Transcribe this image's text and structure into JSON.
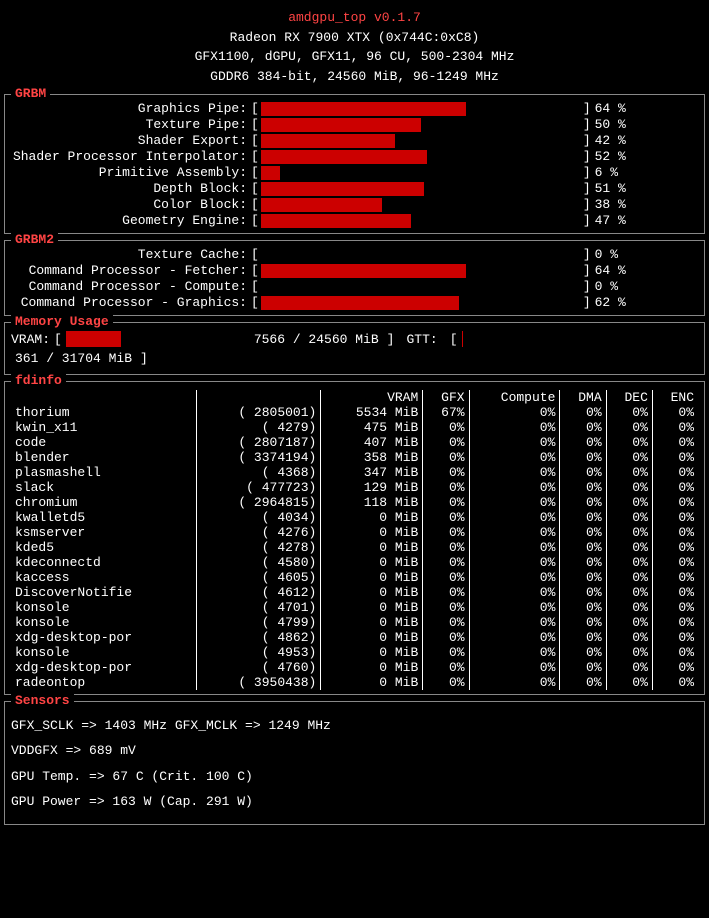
{
  "app": {
    "title": "amdgpu_top v0.1.7",
    "gpu_line1": "Radeon RX 7900 XTX (0x744C:0xC8)",
    "gpu_line2": "GFX1100, dGPU, GFX11, 96 CU, 500-2304 MHz",
    "gpu_line3": "GDDR6 384-bit, 24560 MiB, 96-1249 MHz"
  },
  "grbm": {
    "label": "GRBM",
    "rows": [
      {
        "label": "Graphics Pipe:",
        "pct": 64
      },
      {
        "label": "Texture Pipe:",
        "pct": 50
      },
      {
        "label": "Shader Export:",
        "pct": 42
      },
      {
        "label": "Shader Processor Interpolator:",
        "pct": 52
      },
      {
        "label": "Primitive Assembly:",
        "pct": 6
      },
      {
        "label": "Depth Block:",
        "pct": 51
      },
      {
        "label": "Color Block:",
        "pct": 38
      },
      {
        "label": "Geometry Engine:",
        "pct": 47
      }
    ]
  },
  "grbm2": {
    "label": "GRBM2",
    "rows": [
      {
        "label": "Texture Cache:",
        "pct": 0
      },
      {
        "label": "Command Processor -  Fetcher:",
        "pct": 64
      },
      {
        "label": "Command Processor -  Compute:",
        "pct": 0
      },
      {
        "label": "Command Processor - Graphics:",
        "pct": 62
      }
    ]
  },
  "memory": {
    "label": "Memory Usage",
    "vram_label": "VRAM:",
    "vram_used": 7566,
    "vram_total": 24560,
    "vram_unit": "MiB",
    "vram_pct": 30.8,
    "gtt_label": "GTT:",
    "gtt_used": 361,
    "gtt_total": 31704,
    "gtt_unit": "MiB",
    "gtt_pct": 1.1
  },
  "fdinfo": {
    "label": "fdinfo",
    "headers": [
      "",
      "",
      "VRAM",
      "GFX",
      "Compute",
      "DMA",
      "DEC",
      "ENC"
    ],
    "rows": [
      {
        "name": "thorium",
        "pid": "2805001",
        "vram": "5534 MiB",
        "gfx": "67%",
        "compute": "0%",
        "dma": "0%",
        "dec": "0%",
        "enc": "0%"
      },
      {
        "name": "kwin_x11",
        "pid": "4279",
        "vram": "475 MiB",
        "gfx": "0%",
        "compute": "0%",
        "dma": "0%",
        "dec": "0%",
        "enc": "0%"
      },
      {
        "name": "code",
        "pid": "2807187",
        "vram": "407 MiB",
        "gfx": "0%",
        "compute": "0%",
        "dma": "0%",
        "dec": "0%",
        "enc": "0%"
      },
      {
        "name": "blender",
        "pid": "3374194",
        "vram": "358 MiB",
        "gfx": "0%",
        "compute": "0%",
        "dma": "0%",
        "dec": "0%",
        "enc": "0%"
      },
      {
        "name": "plasmashell",
        "pid": "4368",
        "vram": "347 MiB",
        "gfx": "0%",
        "compute": "0%",
        "dma": "0%",
        "dec": "0%",
        "enc": "0%"
      },
      {
        "name": "slack",
        "pid": "477723",
        "vram": "129 MiB",
        "gfx": "0%",
        "compute": "0%",
        "dma": "0%",
        "dec": "0%",
        "enc": "0%"
      },
      {
        "name": "chromium",
        "pid": "2964815",
        "vram": "118 MiB",
        "gfx": "0%",
        "compute": "0%",
        "dma": "0%",
        "dec": "0%",
        "enc": "0%"
      },
      {
        "name": "kwalletd5",
        "pid": "4034",
        "vram": "0 MiB",
        "gfx": "0%",
        "compute": "0%",
        "dma": "0%",
        "dec": "0%",
        "enc": "0%"
      },
      {
        "name": "ksmserver",
        "pid": "4276",
        "vram": "0 MiB",
        "gfx": "0%",
        "compute": "0%",
        "dma": "0%",
        "dec": "0%",
        "enc": "0%"
      },
      {
        "name": "kded5",
        "pid": "4278",
        "vram": "0 MiB",
        "gfx": "0%",
        "compute": "0%",
        "dma": "0%",
        "dec": "0%",
        "enc": "0%"
      },
      {
        "name": "kdeconnectd",
        "pid": "4580",
        "vram": "0 MiB",
        "gfx": "0%",
        "compute": "0%",
        "dma": "0%",
        "dec": "0%",
        "enc": "0%"
      },
      {
        "name": "kaccess",
        "pid": "4605",
        "vram": "0 MiB",
        "gfx": "0%",
        "compute": "0%",
        "dma": "0%",
        "dec": "0%",
        "enc": "0%"
      },
      {
        "name": "DiscoverNotifie",
        "pid": "4612",
        "vram": "0 MiB",
        "gfx": "0%",
        "compute": "0%",
        "dma": "0%",
        "dec": "0%",
        "enc": "0%"
      },
      {
        "name": "konsole",
        "pid": "4701",
        "vram": "0 MiB",
        "gfx": "0%",
        "compute": "0%",
        "dma": "0%",
        "dec": "0%",
        "enc": "0%"
      },
      {
        "name": "konsole",
        "pid": "4799",
        "vram": "0 MiB",
        "gfx": "0%",
        "compute": "0%",
        "dma": "0%",
        "dec": "0%",
        "enc": "0%"
      },
      {
        "name": "xdg-desktop-por",
        "pid": "4862",
        "vram": "0 MiB",
        "gfx": "0%",
        "compute": "0%",
        "dma": "0%",
        "dec": "0%",
        "enc": "0%"
      },
      {
        "name": "konsole",
        "pid": "4953",
        "vram": "0 MiB",
        "gfx": "0%",
        "compute": "0%",
        "dma": "0%",
        "dec": "0%",
        "enc": "0%"
      },
      {
        "name": "xdg-desktop-por",
        "pid": "4760",
        "vram": "0 MiB",
        "gfx": "0%",
        "compute": "0%",
        "dma": "0%",
        "dec": "0%",
        "enc": "0%"
      },
      {
        "name": "radeontop",
        "pid": "3950438",
        "vram": "0 MiB",
        "gfx": "0%",
        "compute": "0%",
        "dma": "0%",
        "dec": "0%",
        "enc": "0%"
      }
    ]
  },
  "sensors": {
    "label": "Sensors",
    "rows": [
      {
        "left_key": "GFX_SCLK",
        "left_arrow": "=>",
        "left_val": "1403 MHz",
        "right_key": "GFX_MCLK",
        "right_arrow": "=>",
        "right_val": "1249 MHz"
      },
      {
        "left_key": "VDDGFX",
        "left_arrow": "=>",
        "left_val": "689 mV",
        "right_key": "",
        "right_arrow": "",
        "right_val": ""
      },
      {
        "left_key": "GPU Temp.",
        "left_arrow": "=>",
        "left_val": "67 C (Crit. 100 C)",
        "right_key": "",
        "right_arrow": "",
        "right_val": ""
      },
      {
        "left_key": "GPU Power",
        "left_arrow": "=>",
        "left_val": "163 W (Cap. 291 W)",
        "right_key": "",
        "right_arrow": "",
        "right_val": ""
      }
    ]
  }
}
